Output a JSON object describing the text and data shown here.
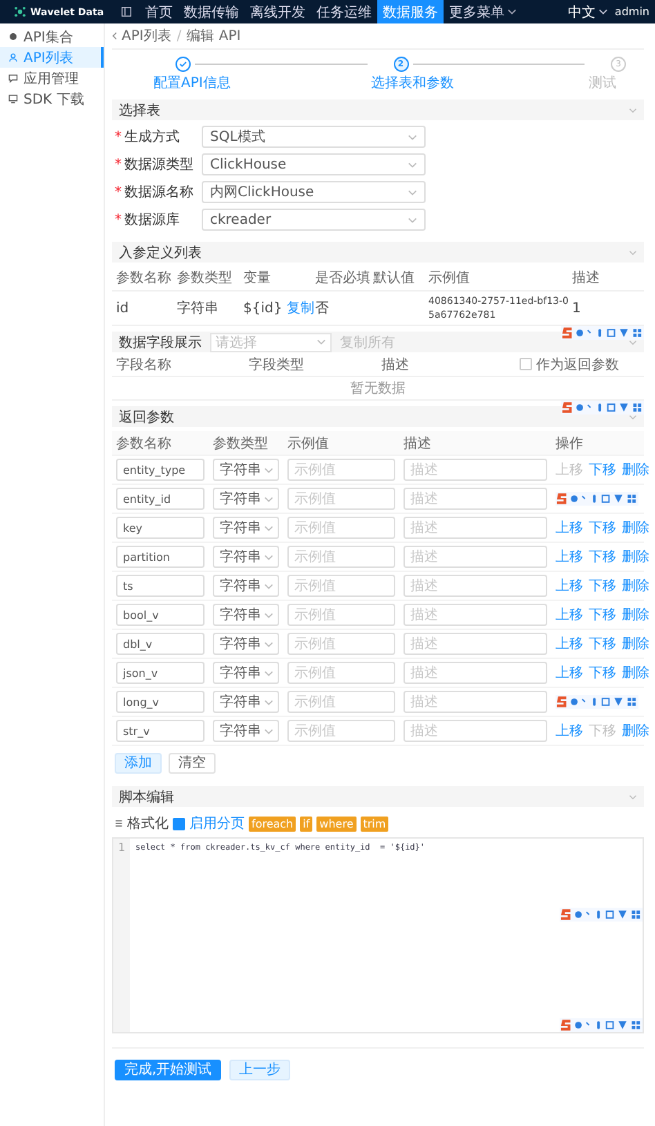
{
  "topbar": {
    "brand": "Wavelet Data",
    "menu": [
      {
        "label": "首页",
        "selected": false
      },
      {
        "label": "数据传输",
        "selected": false
      },
      {
        "label": "离线开发",
        "selected": false
      },
      {
        "label": "任务运维",
        "selected": false
      },
      {
        "label": "数据服务",
        "selected": true
      },
      {
        "label": "更多菜单",
        "selected": false,
        "dropdown": true
      }
    ],
    "language": "中文",
    "user": "admin"
  },
  "sidebar": {
    "items": [
      {
        "label": "API集合",
        "selected": false
      },
      {
        "label": "API列表",
        "selected": true
      },
      {
        "label": "应用管理",
        "selected": false
      },
      {
        "label": "SDK 下载",
        "selected": false
      }
    ]
  },
  "breadcrumb": {
    "back": "API列表",
    "separator": "/",
    "current": "编辑 API"
  },
  "steps": [
    {
      "label": "配置API信息",
      "done": true,
      "selected": false
    },
    {
      "label": "选择表和参数",
      "done": false,
      "selected": true,
      "number": "2"
    },
    {
      "label": "测试",
      "done": false,
      "selected": false,
      "number": "3"
    }
  ],
  "table_section": {
    "title": "选择表",
    "required_mark": "*",
    "fields": [
      {
        "label": "生成方式",
        "value": "SQL模式",
        "required": true
      },
      {
        "label": "数据源类型",
        "value": "ClickHouse",
        "required": true
      },
      {
        "label": "数据源名称",
        "value": "内网ClickHouse",
        "required": true
      },
      {
        "label": "数据源库",
        "value": "ckreader",
        "required": true
      }
    ]
  },
  "input_params": {
    "title": "入参定义列表",
    "columns": [
      "参数名称",
      "参数类型",
      "变量",
      "是否必填",
      "默认值",
      "示例值",
      "描述"
    ],
    "rows": [
      {
        "name": "id",
        "type": "字符串",
        "variable": "${id}",
        "copy": "复制",
        "required": "否",
        "example": "40861340-2757-11ed-bf13-05a67762e781",
        "description": "1"
      }
    ]
  },
  "field_display": {
    "title": "数据字段展示",
    "select_placeholder": "请选择",
    "copy_all": "复制所有",
    "columns": [
      "字段名称",
      "字段类型",
      "描述"
    ],
    "checkbox_label": "作为返回参数",
    "checked": false,
    "empty": "暂无数据"
  },
  "return_params": {
    "title": "返回参数",
    "columns": [
      "参数名称",
      "参数类型",
      "示例值",
      "描述",
      "操作"
    ],
    "rows": [
      {
        "name": "entity_type",
        "type": "字符串",
        "example_placeholder": "示例值",
        "description_placeholder": "描述",
        "actions": [
          {
            "label": "上移",
            "disabled": true
          },
          {
            "label": "下移",
            "disabled": false
          },
          {
            "label": "删除",
            "disabled": false
          }
        ]
      },
      {
        "name": "entity_id",
        "type": "字符串",
        "example_placeholder": "示例值",
        "description_placeholder": "描述"
      },
      {
        "name": "key",
        "type": "字符串",
        "example_placeholder": "示例值",
        "description_placeholder": "描述",
        "actions": [
          {
            "label": "上移",
            "disabled": false
          },
          {
            "label": "下移",
            "disabled": false
          },
          {
            "label": "删除",
            "disabled": false
          }
        ]
      },
      {
        "name": "partition",
        "type": "字符串",
        "example_placeholder": "示例值",
        "description_placeholder": "描述",
        "actions": [
          {
            "label": "上移",
            "disabled": false
          },
          {
            "label": "下移",
            "disabled": false
          },
          {
            "label": "删除",
            "disabled": false
          }
        ]
      },
      {
        "name": "ts",
        "type": "字符串",
        "example_placeholder": "示例值",
        "description_placeholder": "描述",
        "actions": [
          {
            "label": "上移",
            "disabled": false
          },
          {
            "label": "下移",
            "disabled": false
          },
          {
            "label": "删除",
            "disabled": false
          }
        ]
      },
      {
        "name": "bool_v",
        "type": "字符串",
        "example_placeholder": "示例值",
        "description_placeholder": "描述",
        "actions": [
          {
            "label": "上移",
            "disabled": false
          },
          {
            "label": "下移",
            "disabled": false
          },
          {
            "label": "删除",
            "disabled": false
          }
        ]
      },
      {
        "name": "dbl_v",
        "type": "字符串",
        "example_placeholder": "示例值",
        "description_placeholder": "描述",
        "actions": [
          {
            "label": "上移",
            "disabled": false
          },
          {
            "label": "下移",
            "disabled": false
          },
          {
            "label": "删除",
            "disabled": false
          }
        ]
      },
      {
        "name": "json_v",
        "type": "字符串",
        "example_placeholder": "示例值",
        "description_placeholder": "描述",
        "actions": [
          {
            "label": "上移",
            "disabled": false
          },
          {
            "label": "下移",
            "disabled": false
          },
          {
            "label": "删除",
            "disabled": false
          }
        ]
      },
      {
        "name": "long_v",
        "type": "字符串",
        "example_placeholder": "示例值",
        "description_placeholder": "描述"
      },
      {
        "name": "str_v",
        "type": "字符串",
        "example_placeholder": "示例值",
        "description_placeholder": "描述",
        "actions": [
          {
            "label": "上移",
            "disabled": false
          },
          {
            "label": "下移",
            "disabled": true
          },
          {
            "label": "删除",
            "disabled": false
          }
        ]
      }
    ],
    "add": "添加",
    "clear": "清空"
  },
  "script": {
    "title": "脚本编辑",
    "format": "格式化",
    "paging": "启用分页",
    "paging_checked": true,
    "tags": [
      "foreach",
      "if",
      "where",
      "trim"
    ],
    "lines": [
      {
        "number": "1",
        "code": "select * from ckreader.ts_kv_cf where entity_id  = '${id}'"
      }
    ]
  },
  "footer": {
    "primary": "完成,开始测试",
    "secondary": "上一步"
  }
}
